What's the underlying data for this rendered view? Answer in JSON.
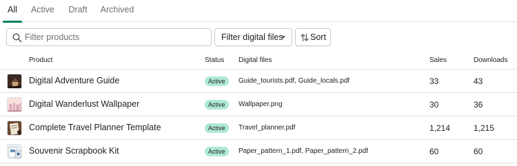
{
  "tabs": [
    {
      "label": "All",
      "active": true
    },
    {
      "label": "Active",
      "active": false
    },
    {
      "label": "Draft",
      "active": false
    },
    {
      "label": "Archived",
      "active": false
    }
  ],
  "toolbar": {
    "search_placeholder": "Filter products",
    "search_value": "",
    "filter_label": "Filter digital files",
    "sort_label": "Sort"
  },
  "table": {
    "headers": {
      "product": "Product",
      "status": "Status",
      "files": "Digital files",
      "sales": "Sales",
      "downloads": "Downloads"
    },
    "rows": [
      {
        "name": "Digital Adventure Guide",
        "status": "Active",
        "files": "Guide_tourists.pdf, Guide_locals.pdf",
        "sales": "33",
        "downloads": "43"
      },
      {
        "name": "Digital Wanderlust Wallpaper",
        "status": "Active",
        "files": "Wallpaper.png",
        "sales": "30",
        "downloads": "36"
      },
      {
        "name": "Complete Travel Planner Template",
        "status": "Active",
        "files": "Travel_planner.pdf",
        "sales": "1,214",
        "downloads": "1,215"
      },
      {
        "name": "Souvenir Scrapbook Kit",
        "status": "Active",
        "files": "Paper_pattern_1.pdf, Paper_pattern_2.pdf",
        "sales": "60",
        "downloads": "60"
      }
    ]
  },
  "colors": {
    "accent": "#008060",
    "badge_bg": "#aee9d1",
    "border": "#e1e3e5"
  }
}
